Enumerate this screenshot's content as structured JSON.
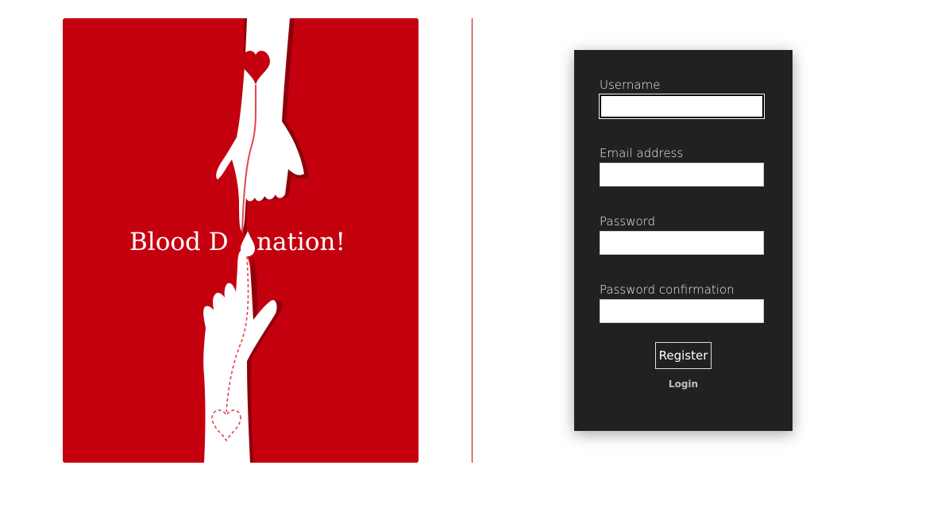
{
  "poster": {
    "title_part1": "Blood D",
    "title_part2": "nation!",
    "background_color": "#c4000f",
    "icon": "blood-drop-icon"
  },
  "form": {
    "username_label": "Username",
    "username_value": "",
    "email_label": "Email address",
    "email_value": "",
    "password_label": "Password",
    "password_value": "",
    "password_confirmation_label": "Password confirmation",
    "password_confirmation_value": "",
    "register_label": "Register",
    "login_label": "Login"
  },
  "colors": {
    "accent": "#c4000f",
    "card_background": "#212121"
  }
}
